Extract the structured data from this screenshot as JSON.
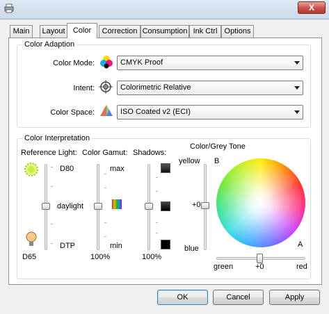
{
  "window": {
    "close_label": "X"
  },
  "tabs": [
    {
      "label": "Main"
    },
    {
      "label": "Layout"
    },
    {
      "label": "Color",
      "active": true
    },
    {
      "label": "Correction"
    },
    {
      "label": "Consumption"
    },
    {
      "label": "Ink Ctrl"
    },
    {
      "label": "Options"
    }
  ],
  "color_adaption": {
    "title": "Color Adaption",
    "mode_label": "Color Mode:",
    "mode_value": "CMYK Proof",
    "intent_label": "Intent:",
    "intent_value": "Colorimetric Relative",
    "space_label": "Color Space:",
    "space_value": "ISO Coated v2 (ECI)"
  },
  "color_interpretation": {
    "title": "Color Interpretation",
    "ref_light": {
      "label": "Reference Light:",
      "top": "D80",
      "middle": "daylight",
      "bottom": "DTP",
      "value": "D65"
    },
    "gamut": {
      "label": "Color Gamut:",
      "top": "max",
      "bottom": "min",
      "value": "100%"
    },
    "shadows": {
      "label": "Shadows:",
      "value": "100%"
    },
    "grey_tone": {
      "label": "Color/Grey Tone",
      "yellow": "yellow",
      "zero": "+0",
      "blue": "blue",
      "b_label": "B",
      "a_label": "A",
      "green": "green",
      "red": "red",
      "h_zero": "+0"
    }
  },
  "buttons": {
    "ok": "OK",
    "cancel": "Cancel",
    "apply": "Apply"
  }
}
